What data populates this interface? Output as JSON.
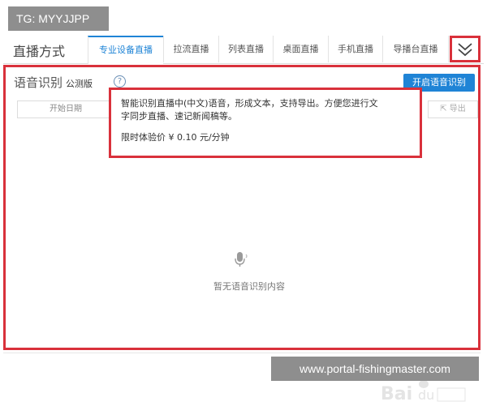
{
  "watermark_top": "TG: MYYJJPP",
  "watermark_bottom": "www.portal-fishingmaster.com",
  "header": {
    "title": "直播方式",
    "tabs": [
      {
        "label": "专业设备直播",
        "active": true
      },
      {
        "label": "拉流直播",
        "active": false
      },
      {
        "label": "列表直播",
        "active": false
      },
      {
        "label": "桌面直播",
        "active": false
      },
      {
        "label": "手机直播",
        "active": false
      },
      {
        "label": "导播台直播",
        "active": false
      }
    ],
    "collapse_icon": "double-chevron-down-icon"
  },
  "panel": {
    "title": "语音识别",
    "badge": "公测版",
    "help_icon": "question-circle-icon",
    "help_glyph": "?",
    "start_button": "开启语音识别",
    "date_placeholder": "开始日期",
    "export_label": "导出",
    "export_icon": "export-icon",
    "tooltip": {
      "line1": "智能识别直播中(中文)语音，形成文本，支持导出。方便您进行文",
      "line2": "字同步直播、速记新闻稿等。",
      "price": "限时体验价 ¥ 0.10 元/分钟"
    },
    "empty_icon": "microphone-icon",
    "empty_text": "暂无语音识别内容"
  },
  "colors": {
    "accent": "#1f84d6",
    "highlight_box": "#d9313b",
    "watermark_bg": "#8e8e8e"
  }
}
